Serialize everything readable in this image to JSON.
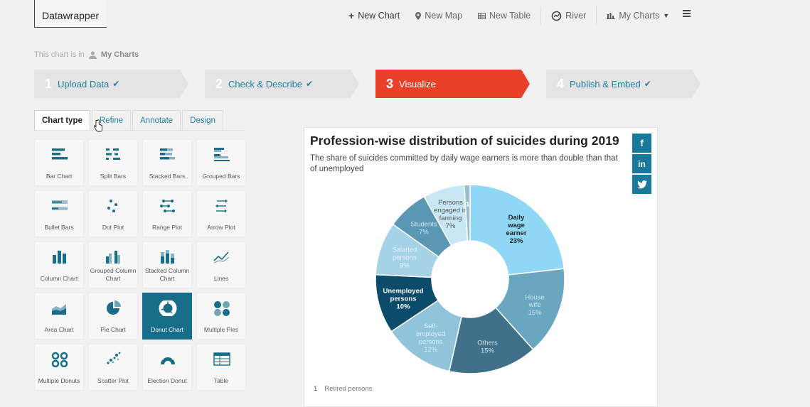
{
  "app": {
    "logo": "Datawrapper"
  },
  "topnav": {
    "new_chart": "New Chart",
    "new_map": "New Map",
    "new_table": "New Table",
    "river": "River",
    "my_charts": "My Charts"
  },
  "location": {
    "prefix": "This chart is in",
    "folder": "My Charts"
  },
  "steps": [
    {
      "num": "1",
      "label": "Upload Data"
    },
    {
      "num": "2",
      "label": "Check & Describe"
    },
    {
      "num": "3",
      "label": "Visualize"
    },
    {
      "num": "4",
      "label": "Publish & Embed"
    }
  ],
  "tabs": [
    "Chart type",
    "Refine",
    "Annotate",
    "Design"
  ],
  "chart_types": [
    {
      "label": "Bar Chart",
      "icon": "bar-chart-icon"
    },
    {
      "label": "Split Bars",
      "icon": "split-bars-icon"
    },
    {
      "label": "Stacked Bars",
      "icon": "stacked-bars-icon"
    },
    {
      "label": "Grouped Bars",
      "icon": "grouped-bars-icon"
    },
    {
      "label": "Bullet Bars",
      "icon": "bullet-bars-icon"
    },
    {
      "label": "Dot Plot",
      "icon": "dot-plot-icon"
    },
    {
      "label": "Range Plot",
      "icon": "range-plot-icon"
    },
    {
      "label": "Arrow Plot",
      "icon": "arrow-plot-icon"
    },
    {
      "label": "Column Chart",
      "icon": "column-chart-icon"
    },
    {
      "label": "Grouped Column Chart",
      "icon": "grouped-column-icon"
    },
    {
      "label": "Stacked Column Chart",
      "icon": "stacked-column-icon"
    },
    {
      "label": "Lines",
      "icon": "lines-icon"
    },
    {
      "label": "Area Chart",
      "icon": "area-chart-icon"
    },
    {
      "label": "Pie Chart",
      "icon": "pie-chart-icon"
    },
    {
      "label": "Donut Chart",
      "icon": "donut-chart-icon"
    },
    {
      "label": "Multiple Pies",
      "icon": "multiple-pies-icon"
    },
    {
      "label": "Multiple Donuts",
      "icon": "multiple-donuts-icon"
    },
    {
      "label": "Scatter Plot",
      "icon": "scatter-plot-icon"
    },
    {
      "label": "Election Donut",
      "icon": "election-donut-icon"
    },
    {
      "label": "Table",
      "icon": "table-icon"
    }
  ],
  "selected_chart_type": "Donut Chart",
  "chart": {
    "title": "Profession-wise distribution of suicides during 2019",
    "subtitle": "The share of suicides committed by daily wage earners is more than double than that of unemployed",
    "social": [
      "f",
      "in",
      "t"
    ],
    "footnote_marker": "1",
    "footnote_text": "Retired persons"
  },
  "chart_data": {
    "type": "donut",
    "slices": [
      {
        "label": "Daily wage earner",
        "value": 23,
        "display": "23%",
        "color": "#8fd7f5",
        "text_color": "#222222"
      },
      {
        "label": "House wife",
        "value": 15,
        "display": "15%",
        "color": "#6aa6c0",
        "text_color": "#c9e6f1"
      },
      {
        "label": "Others",
        "value": 15,
        "display": "15%",
        "color": "#40708a",
        "text_color": "#c9e1ec"
      },
      {
        "label": "Self-employed persons",
        "value": 12,
        "display": "12%",
        "color": "#91c3da",
        "text_color": "#dceff7"
      },
      {
        "label": "Unemployed persons",
        "value": 10,
        "display": "10%",
        "color": "#0c4c6a",
        "text_color": "#ffffff"
      },
      {
        "label": "Salaried persons",
        "value": 9,
        "display": "9%",
        "color": "#a6d2e7",
        "text_color": "#e6f4fa"
      },
      {
        "label": "Students",
        "value": 7,
        "display": "7%",
        "color": "#5a97b4",
        "text_color": "#d0e6f0"
      },
      {
        "label": "Persons engaged in farming",
        "value": 7,
        "display": "7%",
        "color": "#c8e7f4",
        "text_color": "#555555"
      },
      {
        "label": "1",
        "value": 1,
        "display": "",
        "color": "#9dbfcd",
        "text_color": "#ffffff"
      }
    ]
  },
  "colors": {
    "accent": "#e9402a",
    "link": "#1d81a2",
    "selected": "#186e88"
  }
}
